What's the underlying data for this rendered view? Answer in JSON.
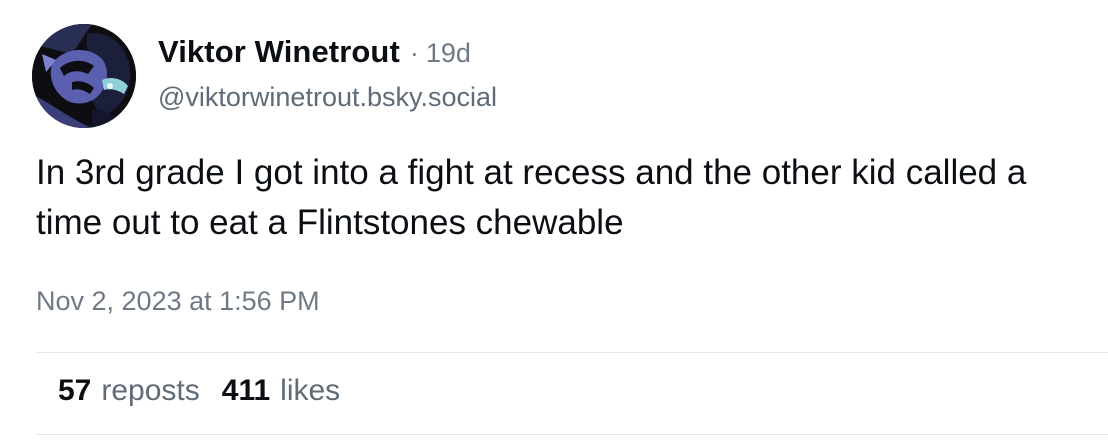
{
  "post": {
    "author": {
      "display_name": "Viktor Winetrout",
      "separator": "·",
      "age": "19d",
      "handle": "@viktorwinetrout.bsky.social",
      "avatar_icon": "comic-portrait-avatar"
    },
    "text": "In 3rd grade I got into a fight at recess and the other kid called a time out to eat a Flintstones chewable",
    "timestamp": "Nov 2, 2023 at 1:56 PM",
    "stats": {
      "reposts_count": "57",
      "reposts_label": "reposts",
      "likes_count": "411",
      "likes_label": "likes"
    }
  },
  "colors": {
    "text_primary": "#0b0f14",
    "text_secondary": "#6f7a86",
    "divider": "#e4e7eb",
    "background": "#ffffff"
  }
}
